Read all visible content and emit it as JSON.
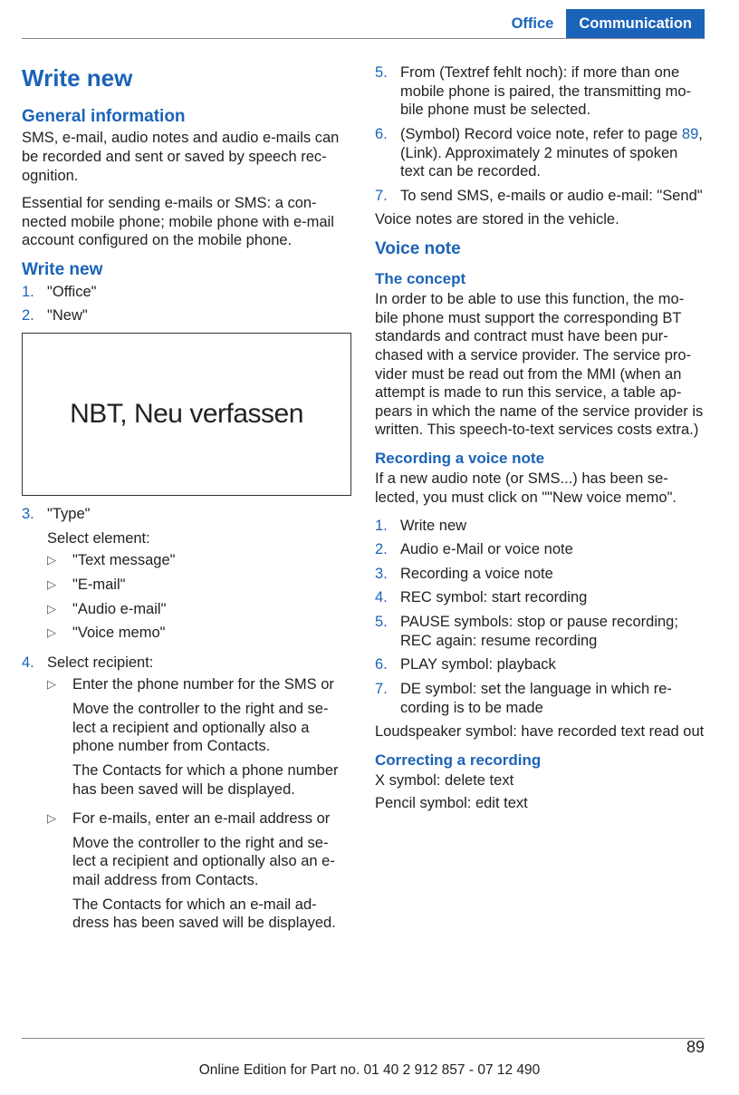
{
  "header": {
    "tab1": "Office",
    "tab2": "Communication"
  },
  "col1": {
    "h1": "Write new",
    "s1_h": "General information",
    "s1_p1": "SMS, e-mail, audio notes and audio e-mails can be recorded and sent or saved by speech rec‐ognition.",
    "s1_p2": "Essential for sending e-mails or SMS: a con‐nected mobile phone; mobile phone with e-mail account configured on the mobile phone.",
    "s2_h": "Write new",
    "li1": "\"Office\"",
    "li2": "\"New\"",
    "img": "NBT, Neu verfassen",
    "li3": "\"Type\"",
    "li3_p": "Select element:",
    "li3_s1": "\"Text message\"",
    "li3_s2": "\"E-mail\"",
    "li3_s3": "\"Audio e-mail\"",
    "li3_s4": "\"Voice memo\"",
    "li4": "Select recipient:",
    "li4_s1a": "Enter the phone number for the SMS or",
    "li4_s1b": "Move the controller to the right and se‐lect a recipient and optionally also a phone number from Contacts.",
    "li4_s1c": "The Contacts for which a phone number has been saved will be displayed.",
    "li4_s2a": "For e-mails, enter an e-mail address or",
    "li4_s2b": "Move the controller to the right and se‐lect a recipient and optionally also an e-mail address from Contacts.",
    "li4_s2c": "The Contacts for which an e-mail ad‐dress has been saved will be displayed."
  },
  "col2": {
    "li5": "From (Textref fehlt noch): if more than one mobile phone is paired, the transmitting mo‐bile phone must be selected.",
    "li6a": "(Symbol) Record voice note, refer to page ",
    "li6_link": "89",
    "li6b": ", (Link). Approximately 2 minutes of spoken text can be recorded.",
    "li7": "To send SMS, e-mails or audio e-mail: \"Send\"",
    "p_after": "Voice notes are stored in the vehicle.",
    "vn_h": "Voice note",
    "vn_c_h": "The concept",
    "vn_c_p": "In order to be able to use this function, the mo‐bile phone must support the corresponding BT standards and contract must have been pur‐chased with a service provider. The service pro‐vider must be read out from the MMI (when an attempt is made to run this service, a table ap‐pears in which the name of the service provider is written. This speech-to-text services costs extra.)",
    "rec_h": "Recording a voice note",
    "rec_p": "If a new audio note (or SMS...) has been se‐lected, you must click on \"\"New voice memo\".",
    "r1": "Write new",
    "r2": "Audio e-Mail or voice note",
    "r3": "Recording a voice note",
    "r4": "REC symbol: start recording",
    "r5": "PAUSE symbols: stop or pause recording; REC again: resume recording",
    "r6": "PLAY symbol: playback",
    "r7": "DE symbol: set the language in which re‐cording is to be made",
    "rec_after": "Loudspeaker symbol: have recorded text read out",
    "cor_h": "Correcting a recording",
    "cor_p1": "X symbol: delete text",
    "cor_p2": "Pencil symbol: edit text"
  },
  "footer": {
    "text": "Online Edition for Part no. 01 40 2 912 857 - 07 12 490",
    "page": "89"
  }
}
